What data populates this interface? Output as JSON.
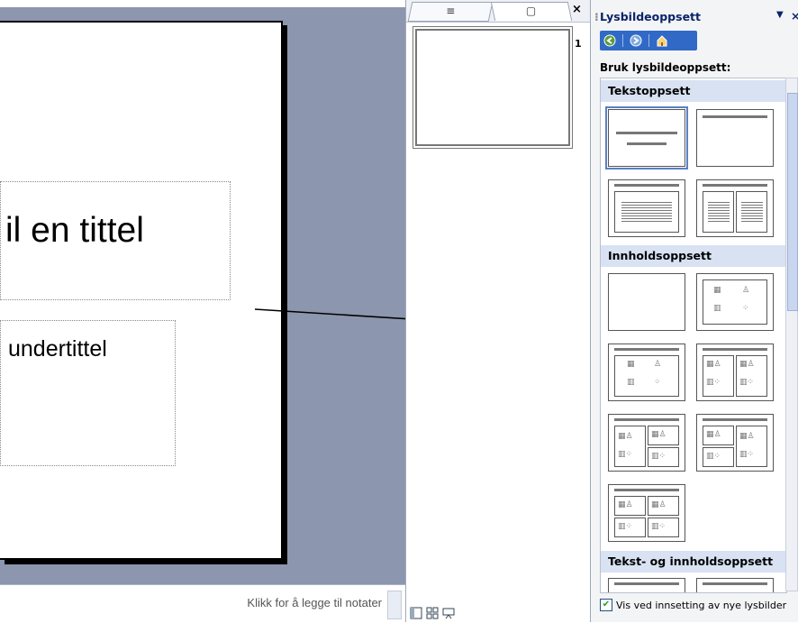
{
  "slide": {
    "title_placeholder": "il en tittel",
    "subtitle_placeholder": "undertittel"
  },
  "notes": {
    "placeholder": "Klikk for å legge til notater"
  },
  "slides_pane": {
    "tabs": [
      {
        "name": "outline",
        "icon": "outline-icon",
        "glyph": "≡"
      },
      {
        "name": "slides",
        "icon": "slide-icon",
        "glyph": "▢"
      }
    ],
    "close": "×",
    "thumbnail_number": "1",
    "view_buttons": [
      "normal-view-icon",
      "slide-sorter-icon",
      "slide-show-icon"
    ]
  },
  "task_pane": {
    "title": "Lysbildeoppsett",
    "dropdown_glyph": "▼",
    "close_glyph": "×",
    "nav": [
      "back-icon",
      "forward-icon",
      "home-icon"
    ],
    "apply_label": "Bruk lysbildeoppsett:",
    "sections": {
      "text_layouts": "Tekstoppsett",
      "content_layouts": "Innholdsoppsett",
      "text_and_content": "Tekst- og innholdsoppsett"
    },
    "footer_checkbox_label": "Vis ved innsetting av nye lysbilder",
    "footer_checkbox_checked": true
  },
  "colors": {
    "task_nav": "#3169c6",
    "section_header": "#d8e2f3",
    "workspace": "#8c96ae"
  }
}
